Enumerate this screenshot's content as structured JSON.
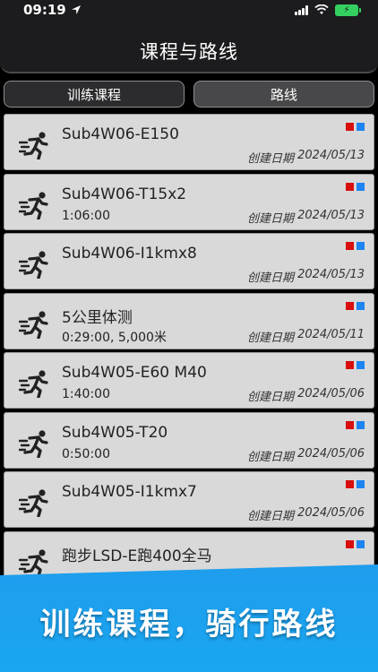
{
  "status_bar": {
    "time": "09:19"
  },
  "header": {
    "title": "课程与路线"
  },
  "tabs": [
    {
      "label": "训练课程"
    },
    {
      "label": "路线"
    }
  ],
  "colors": {
    "marker_red": "#d90e0e",
    "marker_blue": "#1d84f2",
    "banner": "#1f9ded"
  },
  "items": [
    {
      "name": "Sub4W06-E150",
      "detail": "",
      "date_label": "创建日期",
      "date": "2024/05/13"
    },
    {
      "name": "Sub4W06-T15x2",
      "detail": "1:06:00",
      "date_label": "创建日期",
      "date": "2024/05/13"
    },
    {
      "name": "Sub4W06-I1kmx8",
      "detail": "",
      "date_label": "创建日期",
      "date": "2024/05/13"
    },
    {
      "name": "5公里体测",
      "detail": "0:29:00, 5,000米",
      "date_label": "创建日期",
      "date": "2024/05/11"
    },
    {
      "name": "Sub4W05-E60 M40",
      "detail": "1:40:00",
      "date_label": "创建日期",
      "date": "2024/05/06"
    },
    {
      "name": "Sub4W05-T20",
      "detail": "0:50:00",
      "date_label": "创建日期",
      "date": "2024/05/06"
    },
    {
      "name": "Sub4W05-I1kmx7",
      "detail": "",
      "date_label": "创建日期",
      "date": "2024/05/06"
    },
    {
      "name": "跑步LSD-E跑400全马",
      "detail": "",
      "date_label": "",
      "date": ""
    }
  ],
  "banner": {
    "text": "训练课程，骑行路线"
  }
}
